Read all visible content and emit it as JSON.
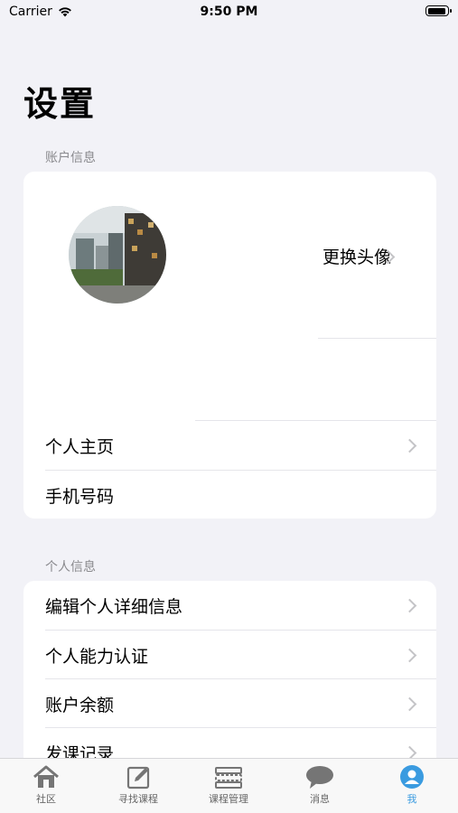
{
  "status_bar": {
    "carrier": "Carrier",
    "time": "9:50 PM"
  },
  "page_title": "设置",
  "sections": {
    "account": {
      "header": "账户信息",
      "change_avatar": "更换头像",
      "rows": [
        {
          "label": "个人主页"
        },
        {
          "label": "手机号码"
        }
      ]
    },
    "personal": {
      "header": "个人信息",
      "rows": [
        {
          "label": "编辑个人详细信息"
        },
        {
          "label": "个人能力认证"
        },
        {
          "label": "账户余额"
        },
        {
          "label": "发课记录"
        }
      ]
    }
  },
  "tabbar": {
    "items": [
      {
        "label": "社区",
        "icon": "home-icon"
      },
      {
        "label": "寻找课程",
        "icon": "edit-icon"
      },
      {
        "label": "课程管理",
        "icon": "list-icon"
      },
      {
        "label": "消息",
        "icon": "chat-bubble-icon"
      },
      {
        "label": "我",
        "icon": "person-icon",
        "active": true
      }
    ],
    "active_color": "#3a9be0"
  }
}
